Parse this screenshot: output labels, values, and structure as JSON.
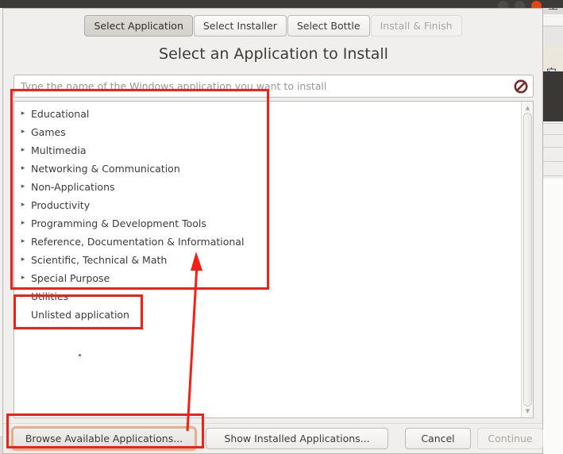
{
  "window": {
    "controls": [
      "minimize",
      "maximize",
      "close"
    ],
    "close_color": "#dd4814"
  },
  "background": {
    "cjk_top": "堂",
    "cjk_mid": "它"
  },
  "dialog": {
    "title": "Select an Application to Install",
    "tabs": [
      {
        "label": "Select Application",
        "state": "active"
      },
      {
        "label": "Select Installer",
        "state": "normal"
      },
      {
        "label": "Select Bottle",
        "state": "normal"
      },
      {
        "label": "Install & Finish",
        "state": "disabled"
      }
    ],
    "search": {
      "value": "",
      "placeholder": "Type the name of the Windows application you want to install",
      "clear_icon": "no-entry-icon",
      "clear_icon_color": "#7a2a2a"
    },
    "categories": [
      {
        "label": "Educational",
        "expander": "▸"
      },
      {
        "label": "Games",
        "expander": "▸"
      },
      {
        "label": "Multimedia",
        "expander": "▸"
      },
      {
        "label": "Networking & Communication",
        "expander": "▸"
      },
      {
        "label": "Non-Applications",
        "expander": "▸"
      },
      {
        "label": "Productivity",
        "expander": "▸"
      },
      {
        "label": "Programming & Development Tools",
        "expander": "▸"
      },
      {
        "label": "Reference, Documentation & Informational",
        "expander": "▸"
      },
      {
        "label": "Scientific, Technical & Math",
        "expander": "▸"
      },
      {
        "label": "Special Purpose",
        "expander": "▸"
      },
      {
        "label": "Utilities",
        "expander": "▸"
      }
    ],
    "unlisted_item": {
      "label": "Unlisted application"
    },
    "scrollbar": {
      "up_arrow": "▲",
      "down_arrow": "▼"
    },
    "buttons": [
      {
        "id": "browse",
        "label": "Browse Available Applications...",
        "state": "focused"
      },
      {
        "id": "installed",
        "label": "Show Installed Applications...",
        "state": "normal"
      },
      {
        "id": "cancel",
        "label": "Cancel",
        "state": "normal"
      },
      {
        "id": "continue",
        "label": "Continue",
        "state": "disabled"
      }
    ]
  },
  "annotations": {
    "accent_color": "#f41f15",
    "boxes": [
      "categories-list",
      "unlisted-application",
      "browse-available-applications"
    ],
    "arrow": "browse-button-to-category-list"
  }
}
